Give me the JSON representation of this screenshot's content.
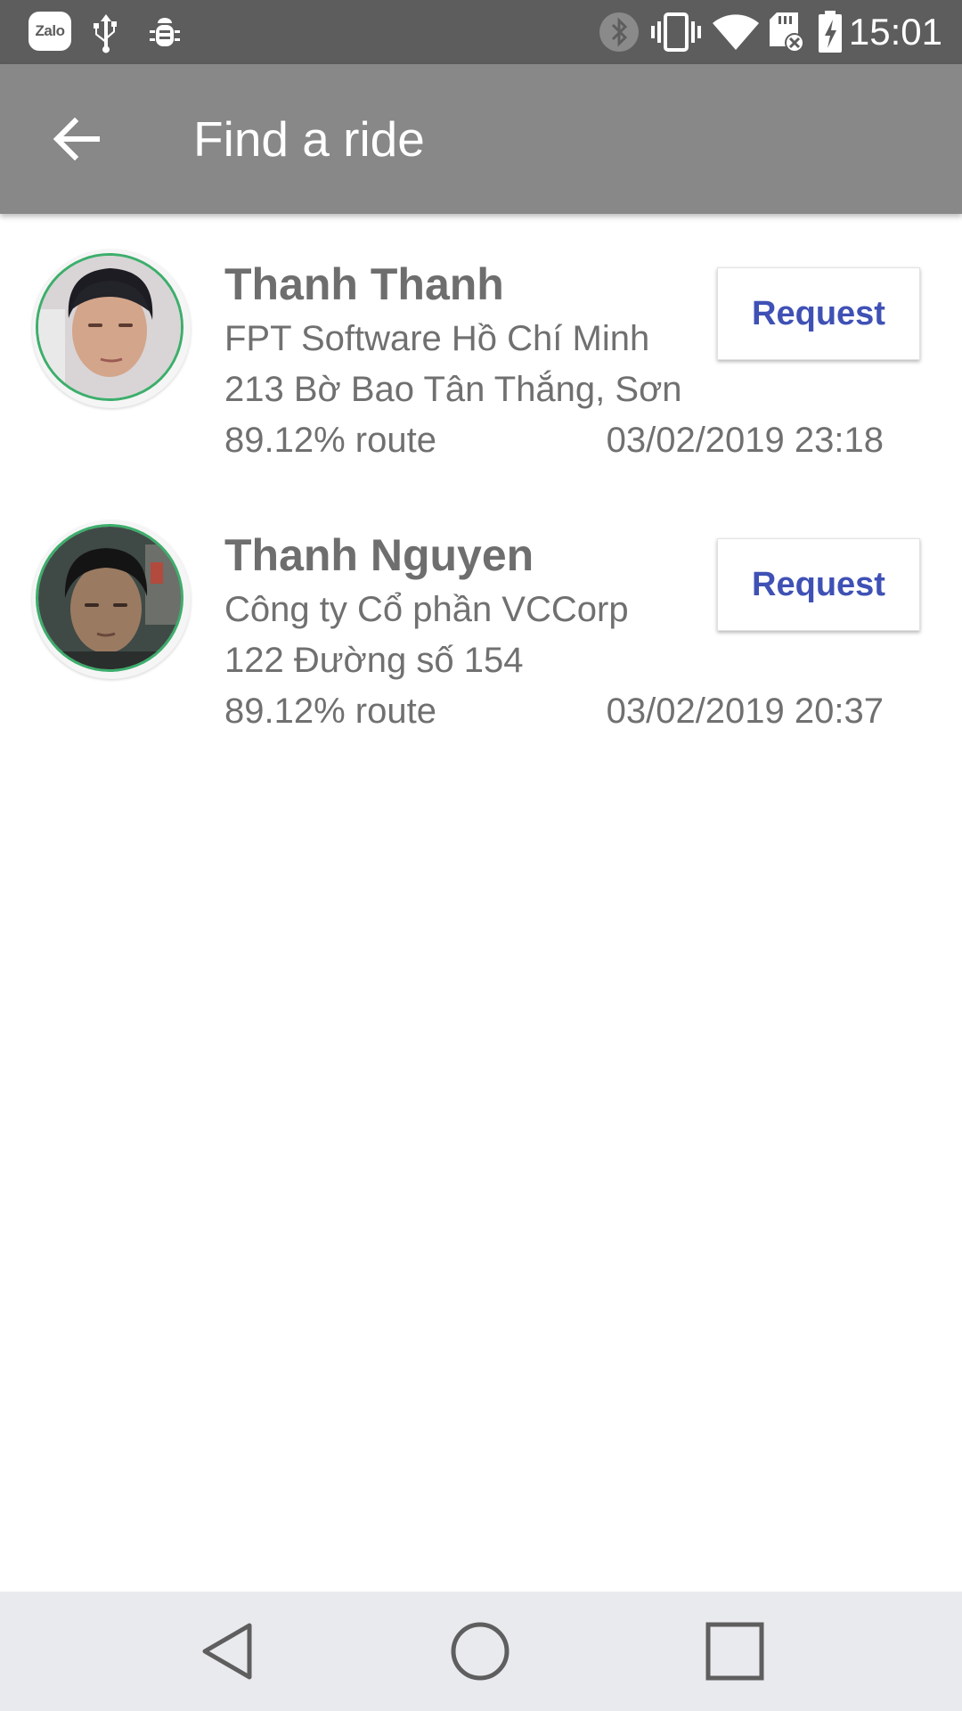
{
  "status_bar": {
    "time": "15:01",
    "zalo_label": "Zalo",
    "left_icons": [
      "zalo-icon",
      "usb-icon",
      "bug-icon"
    ],
    "right_icons": [
      "bluetooth-icon",
      "vibrate-icon",
      "wifi-icon",
      "sd-card-icon",
      "battery-charging-icon"
    ]
  },
  "app_bar": {
    "title": "Find a ride"
  },
  "rides": [
    {
      "name": "Thanh Thanh",
      "company": "FPT Software Hồ Chí Minh",
      "address": "213 Bờ Bao Tân Thắng, Sơn",
      "route": "89.12% route",
      "datetime": "03/02/2019 23:18",
      "request_label": "Request"
    },
    {
      "name": "Thanh Nguyen",
      "company": "Công ty Cổ phần VCCorp",
      "address": "122 Đường số 154",
      "route": "89.12% route",
      "datetime": "03/02/2019 20:37",
      "request_label": "Request"
    }
  ],
  "nav_bar": {
    "buttons": [
      "back-triangle-icon",
      "home-circle-icon",
      "recents-square-icon"
    ]
  },
  "colors": {
    "status_bar": "#5d5d5d",
    "app_bar": "#888888",
    "accent": "#3f51b5",
    "avatar_ring": "#3cae6b",
    "nav_bar": "#e9eaed"
  }
}
